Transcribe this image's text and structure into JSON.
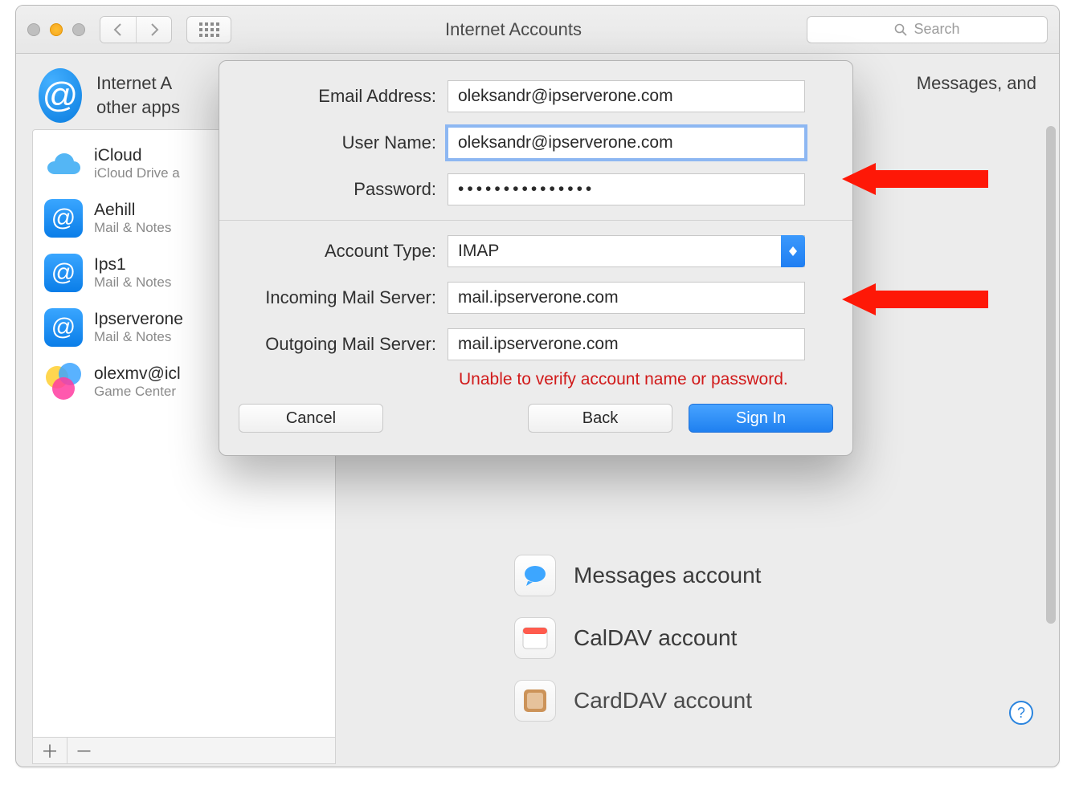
{
  "window": {
    "title": "Internet Accounts",
    "search_placeholder": "Search"
  },
  "header": {
    "line1": "Internet A",
    "line1_right": "Messages, and",
    "line2": "other apps"
  },
  "sidebar": {
    "items": [
      {
        "name": "iCloud",
        "sub": "iCloud Drive a",
        "icon": "icloud"
      },
      {
        "name": "Aehill",
        "sub": "Mail & Notes",
        "icon": "at"
      },
      {
        "name": "Ips1",
        "sub": "Mail & Notes",
        "icon": "at"
      },
      {
        "name": "Ipserverone",
        "sub": "Mail & Notes",
        "icon": "at"
      },
      {
        "name": "olexmv@icl",
        "sub": "Game Center",
        "icon": "gamecenter"
      }
    ]
  },
  "providers": {
    "messages": "Messages account",
    "caldav": "CalDAV account",
    "carddav": "CardDAV account"
  },
  "sheet": {
    "labels": {
      "email": "Email Address:",
      "username": "User Name:",
      "password": "Password:",
      "account_type": "Account Type:",
      "incoming": "Incoming Mail Server:",
      "outgoing": "Outgoing Mail Server:"
    },
    "values": {
      "email": "oleksandr@ipserverone.com",
      "username": "oleksandr@ipserverone.com",
      "password": "•••••••••••••••",
      "account_type": "IMAP",
      "incoming": "mail.ipserverone.com",
      "outgoing": "mail.ipserverone.com"
    },
    "error": "Unable to verify account name or password.",
    "buttons": {
      "cancel": "Cancel",
      "back": "Back",
      "signin": "Sign In"
    }
  }
}
